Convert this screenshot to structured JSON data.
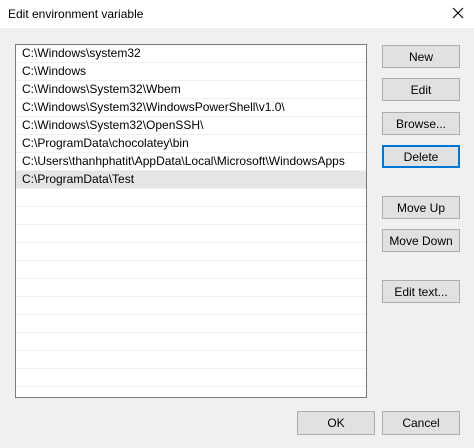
{
  "window": {
    "title": "Edit environment variable",
    "close_icon": "close-icon"
  },
  "paths": [
    "C:\\Windows\\system32",
    "C:\\Windows",
    "C:\\Windows\\System32\\Wbem",
    "C:\\Windows\\System32\\WindowsPowerShell\\v1.0\\",
    "C:\\Windows\\System32\\OpenSSH\\",
    "C:\\ProgramData\\chocolatey\\bin",
    "C:\\Users\\thanhphatit\\AppData\\Local\\Microsoft\\WindowsApps",
    "C:\\ProgramData\\Test"
  ],
  "selected_index": 7,
  "buttons": {
    "new": "New",
    "edit": "Edit",
    "browse": "Browse...",
    "delete": "Delete",
    "move_up": "Move Up",
    "move_down": "Move Down",
    "edit_text": "Edit text...",
    "ok": "OK",
    "cancel": "Cancel"
  },
  "colors": {
    "focus_border": "#0078d7",
    "selection": "#e5e5e5"
  }
}
